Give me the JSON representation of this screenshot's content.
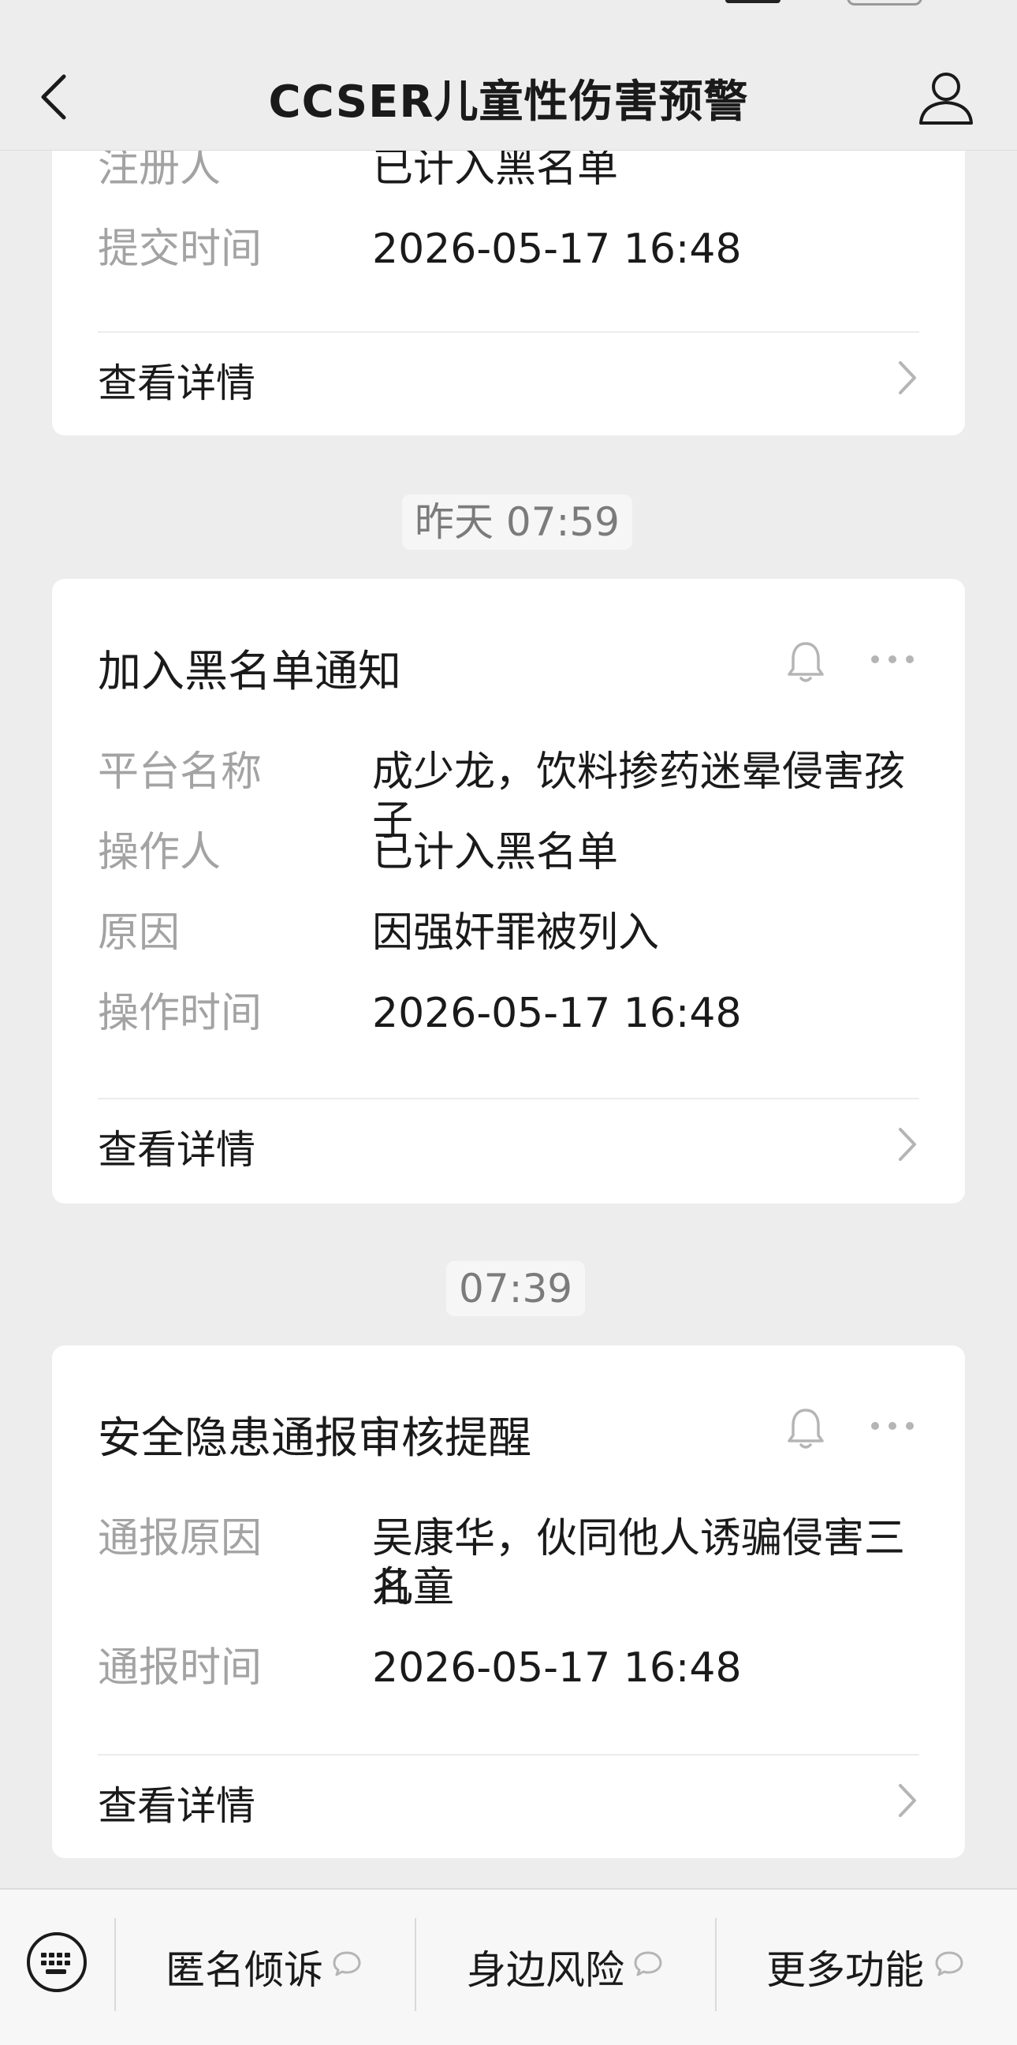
{
  "header": {
    "title": "CCSER儿童性伤害预警"
  },
  "cards": [
    {
      "rows": [
        {
          "key": "注册人",
          "value": "已计入黑名单"
        },
        {
          "key": "提交时间",
          "value": "2026-05-17 16:48"
        }
      ],
      "detail_label": "查看详情"
    },
    {
      "timestamp": "昨天 07:59",
      "title": "加入黑名单通知",
      "rows": [
        {
          "key": "平台名称",
          "value": "成少龙，饮料掺药迷晕侵害孩子"
        },
        {
          "key": "操作人",
          "value": "已计入黑名单"
        },
        {
          "key": "原因",
          "value": "因强奸罪被列入"
        },
        {
          "key": "操作时间",
          "value": "2026-05-17 16:48"
        }
      ],
      "detail_label": "查看详情"
    },
    {
      "timestamp": "07:39",
      "title": "安全隐患通报审核提醒",
      "rows": [
        {
          "key": "通报原因",
          "value": "吴康华，伙同他人诱骗侵害三名",
          "value2": "儿童"
        },
        {
          "key": "通报时间",
          "value": "2026-05-17 16:48"
        }
      ],
      "detail_label": "查看详情"
    }
  ],
  "bottom_menu": [
    {
      "label": "匿名倾诉"
    },
    {
      "label": "身边风险"
    },
    {
      "label": "更多功能"
    }
  ],
  "icons": {
    "back": "chevron-left-icon",
    "profile": "person-icon",
    "bell": "bell-icon",
    "more": "ellipsis-icon",
    "chevron": "chevron-right-icon",
    "keyboard": "keyboard-icon",
    "bubble": "speech-bubble-icon"
  },
  "colors": {
    "background": "#ededed",
    "card": "#ffffff",
    "label_gray": "#a3a3a3",
    "text": "#1a1a1a"
  }
}
